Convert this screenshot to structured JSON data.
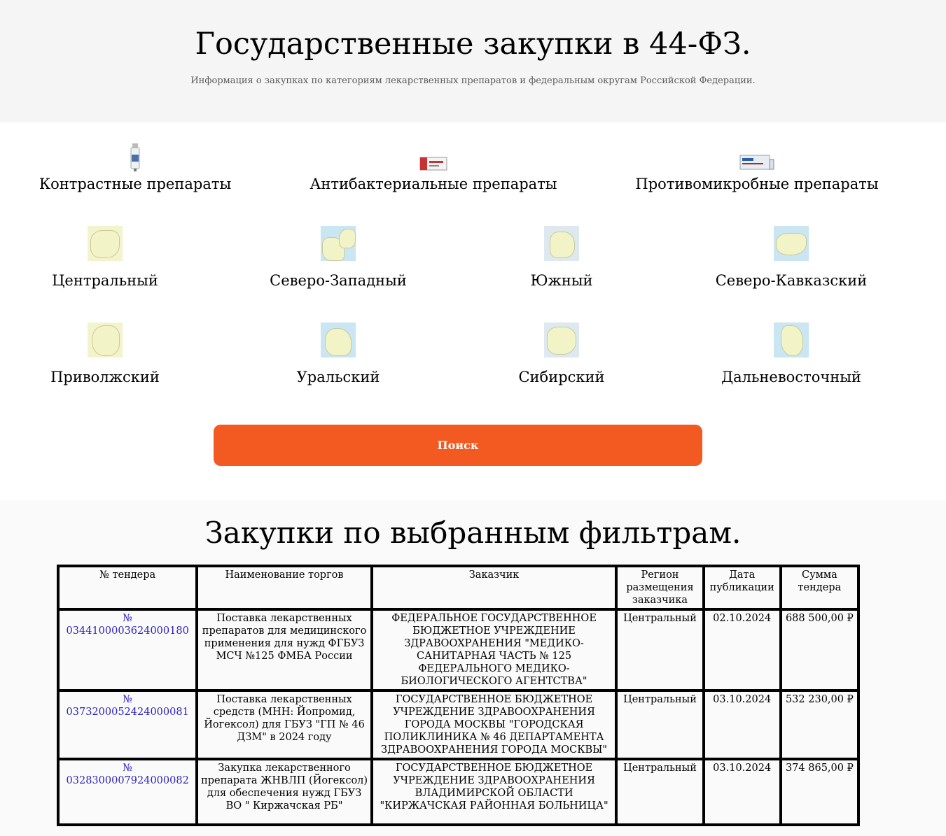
{
  "header": {
    "title": "Государственные закупки в 44-ФЗ.",
    "subtitle": "Информация о закупках по категориям лекарственных препаратов и федеральным округам Российской Федерации."
  },
  "categories": [
    {
      "label": "Контрастные препараты",
      "icon": "vial-icon"
    },
    {
      "label": "Антибактериальные препараты",
      "icon": "pill-box-icon"
    },
    {
      "label": "Противомикробные препараты",
      "icon": "medicine-box-icon"
    }
  ],
  "regions": [
    {
      "label": "Центральный",
      "icon": "map-icon"
    },
    {
      "label": "Северо-Западный",
      "icon": "map-icon"
    },
    {
      "label": "Южный",
      "icon": "map-icon"
    },
    {
      "label": "Северо-Кавказский",
      "icon": "map-icon"
    },
    {
      "label": "Приволжский",
      "icon": "map-icon"
    },
    {
      "label": "Уральский",
      "icon": "map-icon"
    },
    {
      "label": "Сибирский",
      "icon": "map-icon"
    },
    {
      "label": "Дальневосточный",
      "icon": "map-icon"
    }
  ],
  "search": {
    "label": "Поиск",
    "color": "#f25a22"
  },
  "results": {
    "title": "Закупки по выбранным фильтрам.",
    "columns": [
      "№ тендера",
      "Наименование торгов",
      "Заказчик",
      "Регион размещения заказчика",
      "Дата публикации",
      "Сумма тендера"
    ],
    "rows": [
      {
        "tender": "№ 0344100003624000180",
        "name": "Поставка лекарственных препаратов для медицинского применения для нужд ФГБУЗ МСЧ №125 ФМБА России",
        "customer": "ФЕДЕРАЛЬНОЕ ГОСУДАРСТВЕННОЕ БЮДЖЕТНОЕ УЧРЕЖДЕНИЕ ЗДРАВООХРАНЕНИЯ \"МЕДИКО-САНИТАРНАЯ ЧАСТЬ № 125 ФЕДЕРАЛЬНОГО МЕДИКО-БИОЛОГИЧЕСКОГО АГЕНТСТВА\"",
        "region": "Центральный",
        "date": "02.10.2024",
        "sum": "688 500,00 ₽"
      },
      {
        "tender": "№ 0373200052424000081",
        "name": "Поставка лекарственных средств (МНН: Йопромид, Йогексол) для ГБУЗ \"ГП № 46 ДЗМ\" в 2024 году",
        "customer": "ГОСУДАРСТВЕННОЕ БЮДЖЕТНОЕ УЧРЕЖДЕНИЕ ЗДРАВООХРАНЕНИЯ ГОРОДА МОСКВЫ \"ГОРОДСКАЯ ПОЛИКЛИНИКА № 46 ДЕПАРТАМЕНТА ЗДРАВООХРАНЕНИЯ ГОРОДА МОСКВЫ\"",
        "region": "Центральный",
        "date": "03.10.2024",
        "sum": "532 230,00 ₽"
      },
      {
        "tender": "№ 0328300007924000082",
        "name": "Закупка лекарственного препарата ЖНВЛП (Йогексол) для обеспечения нужд ГБУЗ ВО \" Киржачская РБ\"",
        "customer": "ГОСУДАРСТВЕННОЕ БЮДЖЕТНОЕ УЧРЕЖДЕНИЕ ЗДРАВООХРАНЕНИЯ ВЛАДИМИРСКОЙ ОБЛАСТИ \"КИРЖАЧСКАЯ РАЙОННАЯ БОЛЬНИЦА\"",
        "region": "Центральный",
        "date": "03.10.2024",
        "sum": "374 865,00 ₽"
      }
    ]
  }
}
